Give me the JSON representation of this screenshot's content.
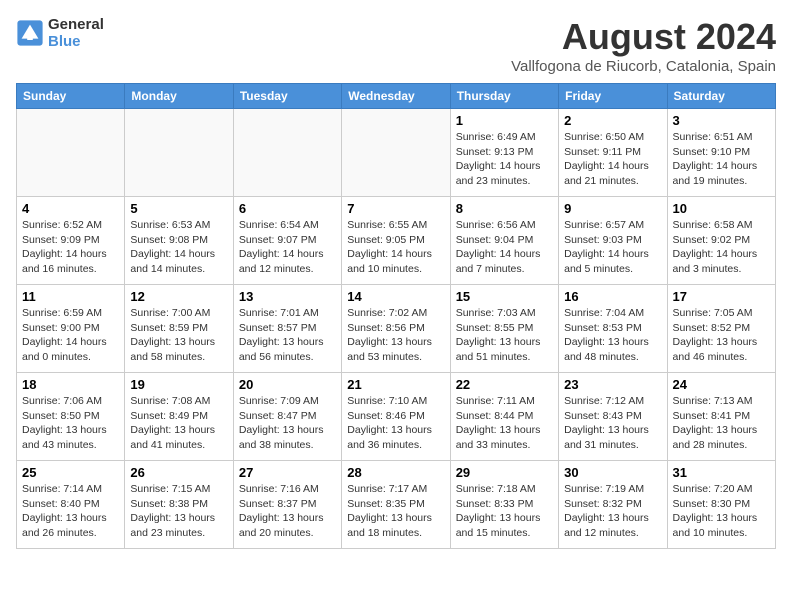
{
  "logo": {
    "line1": "General",
    "line2": "Blue"
  },
  "title": "August 2024",
  "location": "Vallfogona de Riucorb, Catalonia, Spain",
  "days_header": [
    "Sunday",
    "Monday",
    "Tuesday",
    "Wednesday",
    "Thursday",
    "Friday",
    "Saturday"
  ],
  "weeks": [
    [
      {
        "day": "",
        "info": ""
      },
      {
        "day": "",
        "info": ""
      },
      {
        "day": "",
        "info": ""
      },
      {
        "day": "",
        "info": ""
      },
      {
        "day": "1",
        "info": "Sunrise: 6:49 AM\nSunset: 9:13 PM\nDaylight: 14 hours\nand 23 minutes."
      },
      {
        "day": "2",
        "info": "Sunrise: 6:50 AM\nSunset: 9:11 PM\nDaylight: 14 hours\nand 21 minutes."
      },
      {
        "day": "3",
        "info": "Sunrise: 6:51 AM\nSunset: 9:10 PM\nDaylight: 14 hours\nand 19 minutes."
      }
    ],
    [
      {
        "day": "4",
        "info": "Sunrise: 6:52 AM\nSunset: 9:09 PM\nDaylight: 14 hours\nand 16 minutes."
      },
      {
        "day": "5",
        "info": "Sunrise: 6:53 AM\nSunset: 9:08 PM\nDaylight: 14 hours\nand 14 minutes."
      },
      {
        "day": "6",
        "info": "Sunrise: 6:54 AM\nSunset: 9:07 PM\nDaylight: 14 hours\nand 12 minutes."
      },
      {
        "day": "7",
        "info": "Sunrise: 6:55 AM\nSunset: 9:05 PM\nDaylight: 14 hours\nand 10 minutes."
      },
      {
        "day": "8",
        "info": "Sunrise: 6:56 AM\nSunset: 9:04 PM\nDaylight: 14 hours\nand 7 minutes."
      },
      {
        "day": "9",
        "info": "Sunrise: 6:57 AM\nSunset: 9:03 PM\nDaylight: 14 hours\nand 5 minutes."
      },
      {
        "day": "10",
        "info": "Sunrise: 6:58 AM\nSunset: 9:02 PM\nDaylight: 14 hours\nand 3 minutes."
      }
    ],
    [
      {
        "day": "11",
        "info": "Sunrise: 6:59 AM\nSunset: 9:00 PM\nDaylight: 14 hours\nand 0 minutes."
      },
      {
        "day": "12",
        "info": "Sunrise: 7:00 AM\nSunset: 8:59 PM\nDaylight: 13 hours\nand 58 minutes."
      },
      {
        "day": "13",
        "info": "Sunrise: 7:01 AM\nSunset: 8:57 PM\nDaylight: 13 hours\nand 56 minutes."
      },
      {
        "day": "14",
        "info": "Sunrise: 7:02 AM\nSunset: 8:56 PM\nDaylight: 13 hours\nand 53 minutes."
      },
      {
        "day": "15",
        "info": "Sunrise: 7:03 AM\nSunset: 8:55 PM\nDaylight: 13 hours\nand 51 minutes."
      },
      {
        "day": "16",
        "info": "Sunrise: 7:04 AM\nSunset: 8:53 PM\nDaylight: 13 hours\nand 48 minutes."
      },
      {
        "day": "17",
        "info": "Sunrise: 7:05 AM\nSunset: 8:52 PM\nDaylight: 13 hours\nand 46 minutes."
      }
    ],
    [
      {
        "day": "18",
        "info": "Sunrise: 7:06 AM\nSunset: 8:50 PM\nDaylight: 13 hours\nand 43 minutes."
      },
      {
        "day": "19",
        "info": "Sunrise: 7:08 AM\nSunset: 8:49 PM\nDaylight: 13 hours\nand 41 minutes."
      },
      {
        "day": "20",
        "info": "Sunrise: 7:09 AM\nSunset: 8:47 PM\nDaylight: 13 hours\nand 38 minutes."
      },
      {
        "day": "21",
        "info": "Sunrise: 7:10 AM\nSunset: 8:46 PM\nDaylight: 13 hours\nand 36 minutes."
      },
      {
        "day": "22",
        "info": "Sunrise: 7:11 AM\nSunset: 8:44 PM\nDaylight: 13 hours\nand 33 minutes."
      },
      {
        "day": "23",
        "info": "Sunrise: 7:12 AM\nSunset: 8:43 PM\nDaylight: 13 hours\nand 31 minutes."
      },
      {
        "day": "24",
        "info": "Sunrise: 7:13 AM\nSunset: 8:41 PM\nDaylight: 13 hours\nand 28 minutes."
      }
    ],
    [
      {
        "day": "25",
        "info": "Sunrise: 7:14 AM\nSunset: 8:40 PM\nDaylight: 13 hours\nand 26 minutes."
      },
      {
        "day": "26",
        "info": "Sunrise: 7:15 AM\nSunset: 8:38 PM\nDaylight: 13 hours\nand 23 minutes."
      },
      {
        "day": "27",
        "info": "Sunrise: 7:16 AM\nSunset: 8:37 PM\nDaylight: 13 hours\nand 20 minutes."
      },
      {
        "day": "28",
        "info": "Sunrise: 7:17 AM\nSunset: 8:35 PM\nDaylight: 13 hours\nand 18 minutes."
      },
      {
        "day": "29",
        "info": "Sunrise: 7:18 AM\nSunset: 8:33 PM\nDaylight: 13 hours\nand 15 minutes."
      },
      {
        "day": "30",
        "info": "Sunrise: 7:19 AM\nSunset: 8:32 PM\nDaylight: 13 hours\nand 12 minutes."
      },
      {
        "day": "31",
        "info": "Sunrise: 7:20 AM\nSunset: 8:30 PM\nDaylight: 13 hours\nand 10 minutes."
      }
    ]
  ]
}
